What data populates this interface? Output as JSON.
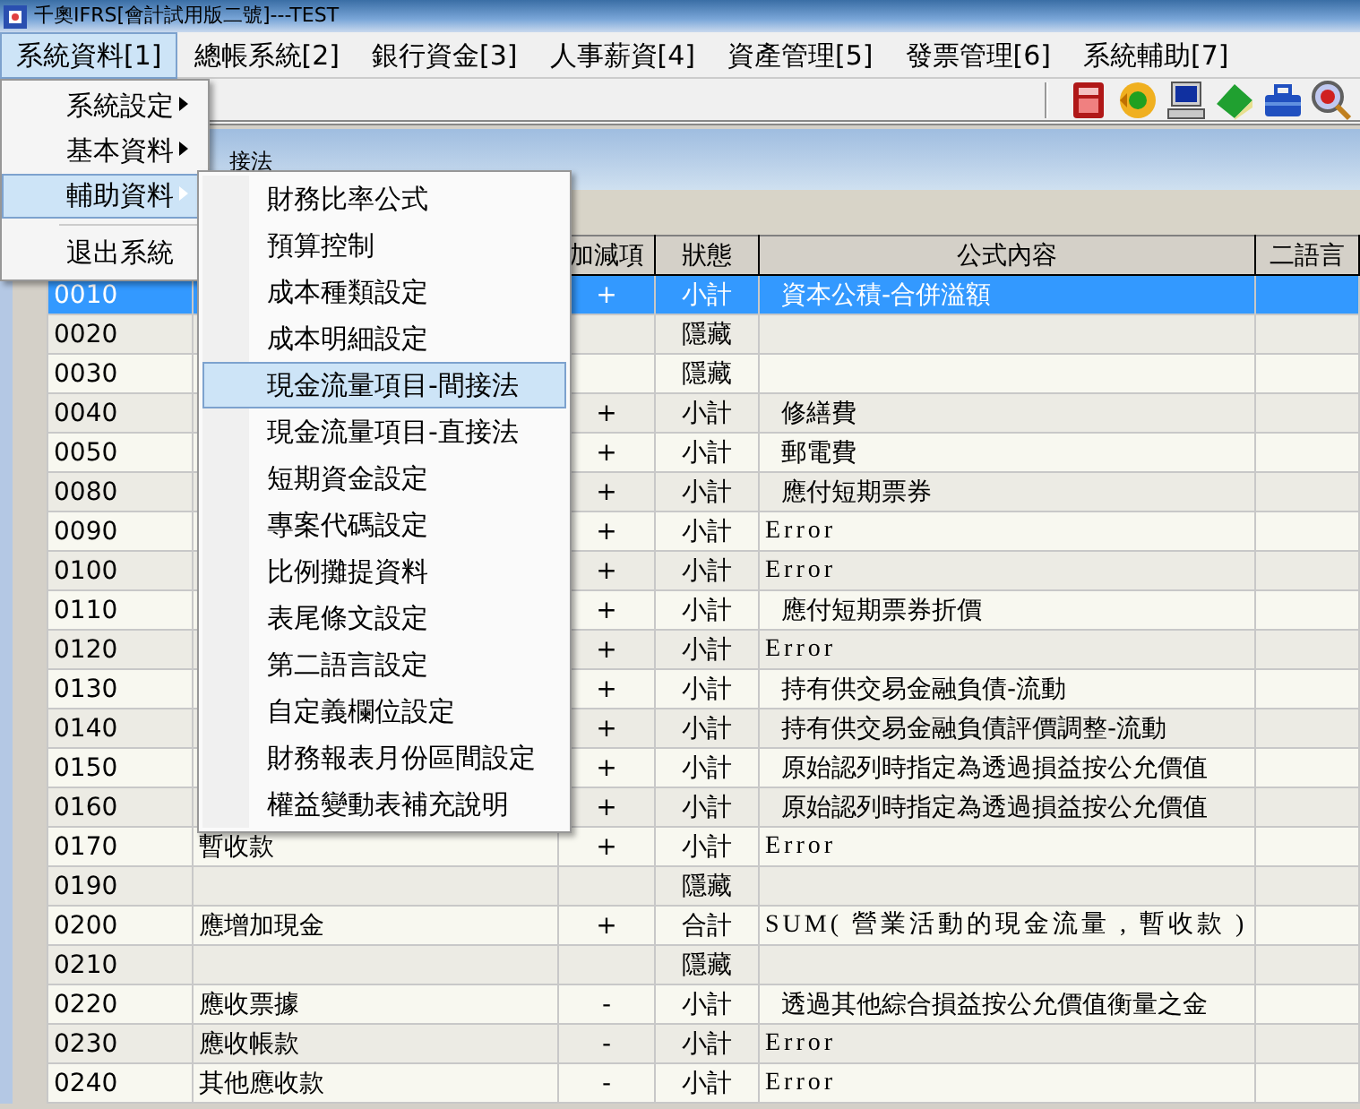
{
  "window": {
    "title": "千奧IFRS[會計試用版二號]---TEST"
  },
  "menu_bar": [
    {
      "label": "系統資料[1]",
      "selected": true
    },
    {
      "label": "總帳系統[2]",
      "selected": false
    },
    {
      "label": "銀行資金[3]",
      "selected": false
    },
    {
      "label": "人事薪資[4]",
      "selected": false
    },
    {
      "label": "資產管理[5]",
      "selected": false
    },
    {
      "label": "發票管理[6]",
      "selected": false
    },
    {
      "label": "系統輔助[7]",
      "selected": false
    }
  ],
  "document_window": {
    "title": "接法"
  },
  "table": {
    "columns": [
      "加減項",
      "狀態",
      "公式內容",
      "二語言"
    ],
    "rows": [
      {
        "code": "0010",
        "sign": "+",
        "status": "小計",
        "formula": "資本公積-合併溢額",
        "formula_indented": true,
        "selected": true
      },
      {
        "code": "0020",
        "status": "隱藏",
        "selected": false
      },
      {
        "code": "0030",
        "status": "隱藏",
        "selected": false
      },
      {
        "code": "0040",
        "sign": "+",
        "status": "小計",
        "formula": "修繕費",
        "formula_indented": true,
        "selected": false
      },
      {
        "code": "0050",
        "sign": "+",
        "status": "小計",
        "formula": "郵電費",
        "formula_indented": true,
        "selected": false
      },
      {
        "code": "0080",
        "sign": "+",
        "status": "小計",
        "formula": "應付短期票券",
        "formula_indented": true,
        "selected": false
      },
      {
        "code": "0090",
        "sign": "+",
        "status": "小計",
        "formula": "Error",
        "formula_indented": false,
        "selected": false
      },
      {
        "code": "0100",
        "sign": "+",
        "status": "小計",
        "formula": "Error",
        "formula_indented": false,
        "selected": false
      },
      {
        "code": "0110",
        "sign": "+",
        "status": "小計",
        "formula": "應付短期票券折價",
        "formula_indented": true,
        "selected": false
      },
      {
        "code": "0120",
        "sign": "+",
        "status": "小計",
        "formula": "Error",
        "formula_indented": false,
        "selected": false
      },
      {
        "code": "0130",
        "sign": "+",
        "status": "小計",
        "formula": "持有供交易金融負債-流動",
        "formula_indented": true,
        "selected": false
      },
      {
        "code": "0140",
        "sign": "+",
        "status": "小計",
        "formula": "持有供交易金融負債評價調整-流動",
        "formula_indented": true,
        "selected": false
      },
      {
        "code": "0150",
        "sign": "+",
        "status": "小計",
        "formula": "原始認列時指定為透過損益按公允價值",
        "formula_indented": true,
        "selected": false
      },
      {
        "code": "0160",
        "sign": "+",
        "status": "小計",
        "formula": "原始認列時指定為透過損益按公允價值",
        "formula_indented": true,
        "selected": false
      },
      {
        "code": "0170",
        "name": "暫收款",
        "sign": "+",
        "status": "小計",
        "formula": "Error",
        "formula_indented": false,
        "selected": false
      },
      {
        "code": "0190",
        "status": "隱藏",
        "selected": false
      },
      {
        "code": "0200",
        "name": "應增加現金",
        "sign": "+",
        "status": "合計",
        "formula": "SUM( 營業活動的現金流量 , 暫收款 )",
        "formula_indented": false,
        "selected": false
      },
      {
        "code": "0210",
        "status": "隱藏",
        "selected": false
      },
      {
        "code": "0220",
        "name": "應收票據",
        "sign": "-",
        "status": "小計",
        "formula": "透過其他綜合損益按公允價值衡量之金",
        "formula_indented": true,
        "selected": false
      },
      {
        "code": "0230",
        "name": "應收帳款",
        "sign": "-",
        "status": "小計",
        "formula": "Error",
        "formula_indented": false,
        "selected": false
      },
      {
        "code": "0240",
        "name": "其他應收款",
        "sign": "-",
        "status": "小計",
        "formula": "Error",
        "formula_indented": false,
        "selected": false
      }
    ]
  },
  "menu": {
    "items": [
      {
        "label": "系統設定",
        "has_submenu": true,
        "selected": false,
        "separator_before": false
      },
      {
        "label": "基本資料",
        "has_submenu": true,
        "selected": false,
        "separator_before": false
      },
      {
        "label": "輔助資料",
        "has_submenu": true,
        "selected": true,
        "separator_before": false
      },
      {
        "label": "退出系統",
        "has_submenu": false,
        "selected": false,
        "separator_before": true
      }
    ]
  },
  "submenu": {
    "items": [
      {
        "label": "財務比率公式",
        "selected": false
      },
      {
        "label": "預算控制",
        "selected": false
      },
      {
        "label": "成本種類設定",
        "selected": false
      },
      {
        "label": "成本明細設定",
        "selected": false
      },
      {
        "label": "現金流量項目-間接法",
        "selected": true
      },
      {
        "label": "現金流量項目-直接法",
        "selected": false
      },
      {
        "label": "短期資金設定",
        "selected": false
      },
      {
        "label": "專案代碼設定",
        "selected": false
      },
      {
        "label": "比例攤提資料",
        "selected": false
      },
      {
        "label": "表尾條文設定",
        "selected": false
      },
      {
        "label": "第二語言設定",
        "selected": false
      },
      {
        "label": "自定義欄位設定",
        "selected": false
      },
      {
        "label": "財務報表月份區間設定",
        "selected": false
      },
      {
        "label": "權益變動表補充說明",
        "selected": false
      }
    ]
  }
}
